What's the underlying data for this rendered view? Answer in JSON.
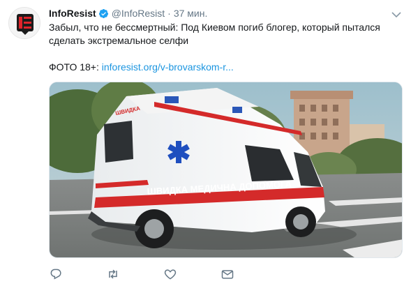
{
  "tweet": {
    "author_name": "InfoResist",
    "handle": "@InfoResist",
    "separator": "·",
    "time": "37 мин.",
    "text_line1": "Забыл, что не бессмертный: Под Киевом погиб блогер, который пытался",
    "text_line2": "сделать экстремальное селфи",
    "photo_label": "ФОТО 18+: ",
    "link_text": "inforesist.org/v-brovarskom-r..."
  },
  "media": {
    "ambulance_text": "ШВИДКА МЕДИЧНА ДОПОМОГА",
    "ambulance_roof_text": "ШВИДКА"
  },
  "icons": {
    "verified": "verified-badge-icon",
    "caret": "chevron-down-icon",
    "reply": "reply-icon",
    "retweet": "retweet-icon",
    "like": "heart-icon",
    "dm": "mail-icon"
  },
  "colors": {
    "accent": "#1da1f2",
    "link": "#1b95e0",
    "muted": "#657786",
    "logo_red": "#e0242b"
  }
}
